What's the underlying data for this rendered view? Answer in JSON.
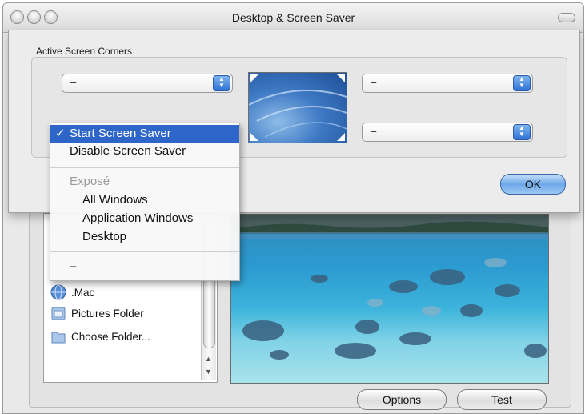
{
  "window": {
    "title": "Desktop & Screen Saver"
  },
  "sheet": {
    "group_label": "Active Screen Corners",
    "corners": {
      "top_left": "–",
      "top_right": "–",
      "bottom_right": "–"
    },
    "ok_label": "OK"
  },
  "menu": {
    "items": [
      {
        "label": "Start Screen Saver",
        "checked": true,
        "check_glyph": "✓"
      },
      {
        "label": "Disable Screen Saver"
      },
      {
        "label": "Exposé",
        "header": true
      },
      {
        "label": "All Windows"
      },
      {
        "label": "Application Windows"
      },
      {
        "label": "Desktop"
      },
      {
        "label": "–"
      }
    ]
  },
  "sidebar": {
    "items": [
      {
        "label": ".Mac",
        "icon": "globe-icon"
      },
      {
        "label": "Pictures Folder",
        "icon": "folder-icon"
      },
      {
        "label": "Choose Folder...",
        "icon": "folder-icon"
      }
    ]
  },
  "buttons": {
    "options": "Options",
    "test": "Test"
  },
  "colors": {
    "selection": "#2d66c8",
    "stepper_blue": "#2e72d5"
  }
}
